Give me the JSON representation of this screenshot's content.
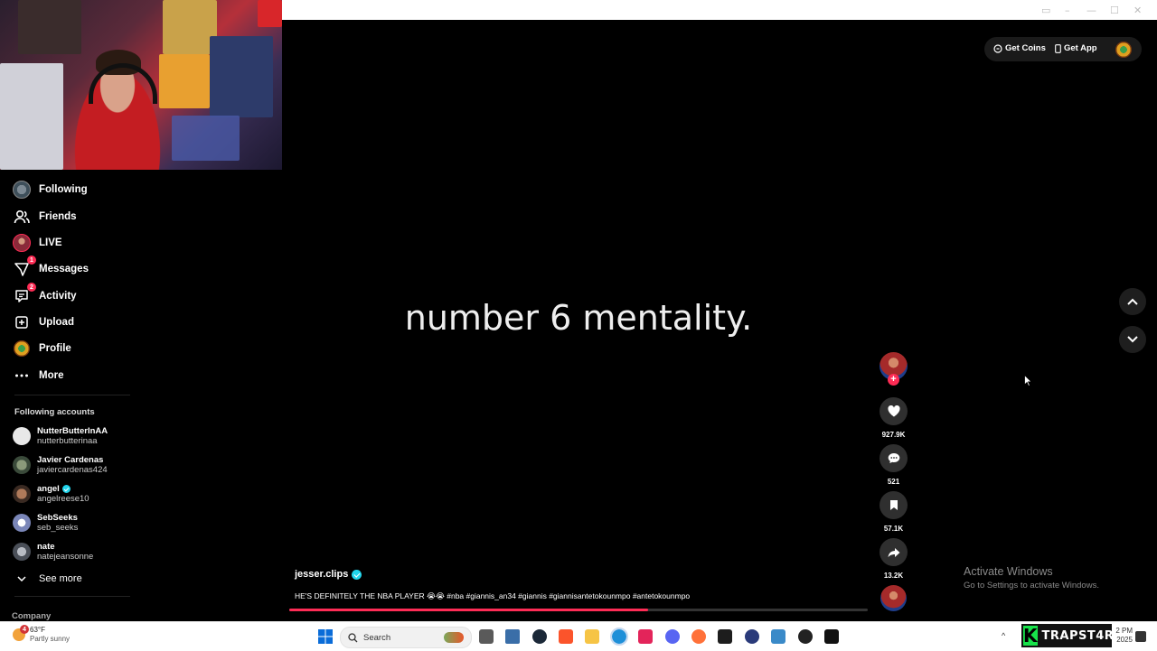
{
  "webcam": {
    "label": "streamer webcam"
  },
  "sidebar": {
    "nav": [
      {
        "label": "Following",
        "icon": "following-avatar-icon",
        "badge": ""
      },
      {
        "label": "Friends",
        "icon": "friends-icon",
        "badge": ""
      },
      {
        "label": "LIVE",
        "icon": "live-icon",
        "badge": ""
      },
      {
        "label": "Messages",
        "icon": "messages-icon",
        "badge": "1"
      },
      {
        "label": "Activity",
        "icon": "activity-icon",
        "badge": "2"
      },
      {
        "label": "Upload",
        "icon": "upload-icon",
        "badge": ""
      },
      {
        "label": "Profile",
        "icon": "profile-avatar-icon",
        "badge": ""
      },
      {
        "label": "More",
        "icon": "more-icon",
        "badge": ""
      }
    ],
    "following_title": "Following accounts",
    "accounts": [
      {
        "name": "NutterButterInAA",
        "handle": "nutterbutterinaa",
        "verified": false,
        "color": "#e8e8e8"
      },
      {
        "name": "Javier Cardenas",
        "handle": "javiercardenas424",
        "verified": false,
        "color": "#556b5a"
      },
      {
        "name": "angel",
        "handle": "angelreese10",
        "verified": true,
        "color": "#6b4a3a"
      },
      {
        "name": "SebSeeks",
        "handle": "seb_seeks",
        "verified": false,
        "color": "#9aa6c8"
      },
      {
        "name": "nate",
        "handle": "natejeansonne",
        "verified": false,
        "color": "#7a7f88"
      }
    ],
    "see_more": "See more",
    "company": "Company"
  },
  "video": {
    "overlay_text": "number 6 mentality.",
    "author": "jesser.clips",
    "author_verified": true,
    "description": "HE'S DEFINITELY THE NBA PLAYER 😭😭 #nba #giannis_an34 #giannis #giannisantetokounmpo #antetokounmpo",
    "progress": 0.62
  },
  "actions": {
    "likes": "927.9K",
    "comments": "521",
    "saves": "57.1K",
    "shares": "13.2K"
  },
  "top": {
    "get_coins": "Get Coins",
    "get_app": "Get App"
  },
  "watermark": {
    "title": "Activate Windows",
    "subtitle": "Go to Settings to activate Windows."
  },
  "taskbar": {
    "weather_temp": "63°F",
    "weather_cond": "Partly sunny",
    "weather_badge": "4",
    "search_placeholder": "Search",
    "brand": "TRAPST4R",
    "time": "2 PM",
    "date": "2025"
  },
  "colors": {
    "accent": "#fe2c55",
    "verified": "#20d5ec",
    "brand_green": "#17e24a"
  }
}
